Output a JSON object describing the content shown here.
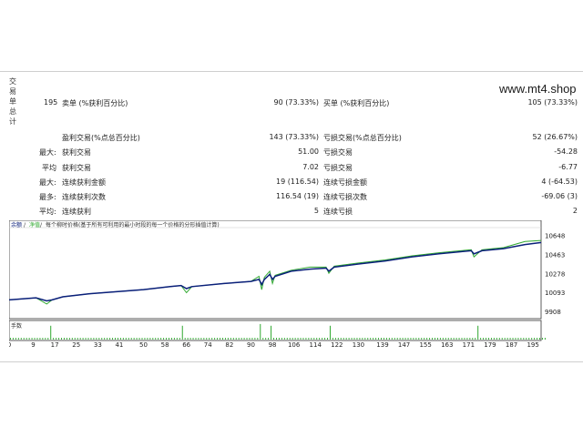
{
  "watermark": "www.mt4.shop",
  "side_title": [
    "交",
    "易",
    "单",
    "总",
    "计"
  ],
  "stats": {
    "r1": {
      "count": "195",
      "short_label": "卖单 (%获利百分比)",
      "short_value": "90 (73.33%)",
      "long_label": "买单 (%获利百分比)",
      "long_value": "105 (73.33%)"
    },
    "r2": {
      "win_label": "盈利交易(%点总百分比)",
      "win_value": "143 (73.33%)",
      "loss_label": "亏损交易(%点总百分比)",
      "loss_value": "52 (26.67%)"
    },
    "r3": {
      "prefix": "最大:",
      "win_label": "获利交易",
      "win_value": "51.00",
      "loss_label": "亏损交易",
      "loss_value": "-54.28"
    },
    "r4": {
      "prefix": "平均",
      "win_label": "获利交易",
      "win_value": "7.02",
      "loss_label": "亏损交易",
      "loss_value": "-6.77"
    },
    "r5": {
      "prefix": "最大:",
      "win_label": "连续获利金额",
      "win_value": "19 (116.54)",
      "loss_label": "连续亏损金额",
      "loss_value": "4 (-64.53)"
    },
    "r6": {
      "prefix": "最多:",
      "win_label": "连续获利次数",
      "win_value": "116.54 (19)",
      "loss_label": "连续亏损次数",
      "loss_value": "-69.06 (3)"
    },
    "r7": {
      "prefix": "平均:",
      "win_label": "连续获利",
      "win_value": "5",
      "loss_label": "连续亏损",
      "loss_value": "2"
    }
  },
  "chart_data": {
    "type": "line",
    "legend_balance": "余额",
    "legend_equity": "净值",
    "legend_desc": "每个柳时价格(基于所有可利用的最小时段的每一个价格的分形插值计算)",
    "volume_label": "手数",
    "colors": {
      "balance": "#0a1f7a",
      "equity": "#2fa82f",
      "volume": "#2fa82f"
    },
    "ylim": [
      9908,
      10690
    ],
    "y_ticks": [
      10648,
      10463,
      10278,
      10093,
      9908
    ],
    "x_ticks": [
      0,
      9,
      17,
      25,
      33,
      41,
      50,
      58,
      66,
      74,
      82,
      90,
      98,
      106,
      114,
      122,
      130,
      139,
      147,
      155,
      163,
      171,
      179,
      187,
      195
    ],
    "xlim": [
      0,
      198
    ],
    "balance": [
      [
        0,
        10020
      ],
      [
        5,
        10030
      ],
      [
        10,
        10040
      ],
      [
        14,
        10010
      ],
      [
        16,
        10020
      ],
      [
        20,
        10050
      ],
      [
        30,
        10080
      ],
      [
        40,
        10100
      ],
      [
        50,
        10120
      ],
      [
        60,
        10150
      ],
      [
        64,
        10160
      ],
      [
        66,
        10130
      ],
      [
        68,
        10150
      ],
      [
        80,
        10180
      ],
      [
        90,
        10200
      ],
      [
        93,
        10220
      ],
      [
        94,
        10170
      ],
      [
        95,
        10220
      ],
      [
        97,
        10270
      ],
      [
        98,
        10220
      ],
      [
        99,
        10250
      ],
      [
        105,
        10300
      ],
      [
        112,
        10320
      ],
      [
        118,
        10330
      ],
      [
        119,
        10300
      ],
      [
        121,
        10340
      ],
      [
        130,
        10370
      ],
      [
        140,
        10400
      ],
      [
        150,
        10440
      ],
      [
        160,
        10470
      ],
      [
        168,
        10490
      ],
      [
        172,
        10500
      ],
      [
        173,
        10470
      ],
      [
        176,
        10500
      ],
      [
        180,
        10510
      ],
      [
        184,
        10520
      ],
      [
        188,
        10540
      ],
      [
        192,
        10560
      ],
      [
        198,
        10580
      ]
    ],
    "equity": [
      [
        0,
        10020
      ],
      [
        5,
        10030
      ],
      [
        10,
        10040
      ],
      [
        14,
        9980
      ],
      [
        16,
        10020
      ],
      [
        20,
        10050
      ],
      [
        30,
        10080
      ],
      [
        40,
        10100
      ],
      [
        50,
        10120
      ],
      [
        60,
        10150
      ],
      [
        64,
        10160
      ],
      [
        66,
        10090
      ],
      [
        68,
        10150
      ],
      [
        80,
        10180
      ],
      [
        90,
        10200
      ],
      [
        93,
        10250
      ],
      [
        94,
        10120
      ],
      [
        95,
        10240
      ],
      [
        97,
        10300
      ],
      [
        98,
        10180
      ],
      [
        99,
        10260
      ],
      [
        105,
        10310
      ],
      [
        112,
        10340
      ],
      [
        118,
        10340
      ],
      [
        119,
        10280
      ],
      [
        121,
        10350
      ],
      [
        130,
        10380
      ],
      [
        140,
        10410
      ],
      [
        150,
        10450
      ],
      [
        160,
        10480
      ],
      [
        168,
        10500
      ],
      [
        172,
        10510
      ],
      [
        173,
        10440
      ],
      [
        176,
        10510
      ],
      [
        180,
        10520
      ],
      [
        184,
        10530
      ],
      [
        188,
        10560
      ],
      [
        192,
        10590
      ],
      [
        198,
        10600
      ]
    ],
    "volume": [
      1,
      1,
      1,
      1,
      1,
      1,
      1,
      1,
      1,
      1,
      1,
      1,
      1,
      1,
      1,
      8,
      1,
      1,
      1,
      1,
      1,
      1,
      1,
      1,
      1,
      1,
      1,
      1,
      1,
      1,
      1,
      1,
      1,
      1,
      1,
      1,
      1,
      1,
      1,
      1,
      1,
      1,
      1,
      1,
      1,
      1,
      1,
      1,
      1,
      1,
      1,
      1,
      1,
      1,
      1,
      1,
      1,
      1,
      1,
      1,
      1,
      1,
      1,
      1,
      8,
      1,
      1,
      1,
      1,
      1,
      1,
      1,
      1,
      1,
      1,
      1,
      1,
      1,
      1,
      1,
      1,
      1,
      1,
      1,
      1,
      1,
      1,
      1,
      1,
      1,
      1,
      1,
      1,
      9,
      1,
      1,
      1,
      8,
      1,
      1,
      1,
      1,
      1,
      1,
      1,
      1,
      1,
      1,
      1,
      1,
      1,
      1,
      1,
      1,
      1,
      1,
      1,
      1,
      1,
      8,
      1,
      1,
      1,
      1,
      1,
      1,
      1,
      1,
      1,
      1,
      1,
      1,
      1,
      1,
      1,
      1,
      1,
      1,
      1,
      1,
      1,
      1,
      1,
      1,
      1,
      1,
      1,
      1,
      1,
      1,
      1,
      1,
      1,
      1,
      1,
      1,
      1,
      1,
      1,
      1,
      1,
      1,
      1,
      1,
      1,
      1,
      1,
      1,
      1,
      1,
      1,
      1,
      1,
      1,
      8,
      1,
      1,
      1,
      1,
      1,
      1,
      1,
      1,
      1,
      1,
      1,
      1,
      1,
      1,
      1,
      1,
      1,
      1,
      1,
      1,
      1,
      1,
      1,
      1,
      1
    ]
  }
}
